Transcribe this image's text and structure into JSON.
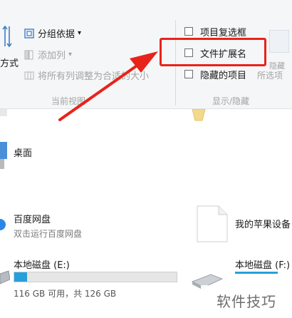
{
  "ribbon": {
    "layout_group": {
      "sort_label": "方式",
      "group_by_label": "分组依据",
      "add_column_label": "添加列",
      "fit_columns_label": "将所有列调整为合适的大小",
      "group_caption": "当前视图"
    },
    "show_hide_group": {
      "item_checkboxes": {
        "label": "项目复选框",
        "checked": false
      },
      "file_extensions": {
        "label": "文件扩展名",
        "checked": false
      },
      "hidden_items": {
        "label": "隐藏的项目",
        "checked": false
      },
      "hide_selected_label": "隐藏",
      "options_label": "所选项",
      "group_caption": "显示/隐藏"
    }
  },
  "content": {
    "desktop": {
      "name": "桌面"
    },
    "baidu": {
      "name": "百度网盘",
      "subtitle": "双击运行百度网盘"
    },
    "apple": {
      "name": "我的苹果设备"
    },
    "disk_e": {
      "name": "本地磁盘 (E:)",
      "free_text": "116 GB 可用，共 126 GB",
      "used_fraction": 0.08
    },
    "disk_f": {
      "name": "本地磁盘 (F:)"
    }
  },
  "watermark": "软件技巧",
  "colors": {
    "highlight_box": "#e8231a",
    "arrow": "#e8231a",
    "drive_fill": "#26a0da"
  }
}
